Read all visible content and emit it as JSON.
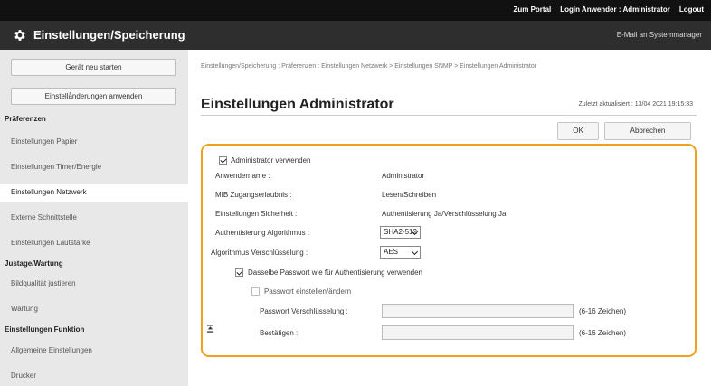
{
  "topbar": {
    "portal": "Zum Portal",
    "login_label": "Login Anwender :",
    "login_user": "Administrator",
    "logout": "Logout"
  },
  "titlebar": {
    "title": "Einstellungen/Speicherung",
    "mail": "E-Mail an Systemmanager",
    "icon": "gear-icon"
  },
  "sidebar": {
    "restart_button": "Gerät neu starten",
    "apply_button": "Einstellånderungen anwenden",
    "sections": [
      {
        "title": "Präferenzen",
        "items": [
          "Einstellungen Papier",
          "Einstellungen Timer/Energie",
          "Einstellungen Netzwerk",
          "Externe Schnittstelle",
          "Einstellungen Lautstärke"
        ]
      },
      {
        "title": "Justage/Wartung",
        "items": [
          "Bildqualität justieren",
          "Wartung"
        ]
      },
      {
        "title": "Einstellungen Funktion",
        "items": [
          "Allgemeine Einstellungen",
          "Drucker"
        ]
      }
    ],
    "active_item": "Einstellungen Netzwerk"
  },
  "main": {
    "breadcrumb": "Einstellungen/Speicherung : Präferenzen : Einstellungen Netzwerk > Einstellungen SNMP > Einstellungen Administrator",
    "page_title": "Einstellungen Administrator",
    "updated": "Zuletzt aktualisiert : 13/04 2021 19:15:33",
    "ok_button": "OK",
    "cancel_button": "Abbrechen",
    "form": {
      "use_admin_label": "Administrator verwenden",
      "use_admin_checked": true,
      "username_label": "Anwendername :",
      "username_value": "Administrator",
      "mib_label": "MIB Zugangserlaubnis :",
      "mib_value": "Lesen/Schreiben",
      "security_label": "Einstellungen Sicherheit :",
      "security_value": "Authentisierung Ja/Verschlüsselung Ja",
      "auth_alg_label": "Authentisierung Algorithmus :",
      "auth_alg_value": "SHA2-512",
      "enc_alg_label": "Algorithmus Verschlüsselung :",
      "enc_alg_value": "AES",
      "same_pw_label": "Dasselbe Passwort wie für Authentisierung verwenden",
      "same_pw_checked": true,
      "set_pw_label": "Passwort einstellen/ändern",
      "set_pw_checked": false,
      "pw_enc_label": "Passwort Verschlüsselung :",
      "pw_enc_value": "",
      "pw_enc_hint": "(6-16 Zeichen)",
      "confirm_label": "Bestätigen :",
      "confirm_value": "",
      "confirm_hint": "(6-16 Zeichen)"
    }
  },
  "colors": {
    "accent": "#f0a21d",
    "topbar": "#111111",
    "titlebar": "#2e2e2e",
    "sidebar": "#e8e8e8"
  }
}
